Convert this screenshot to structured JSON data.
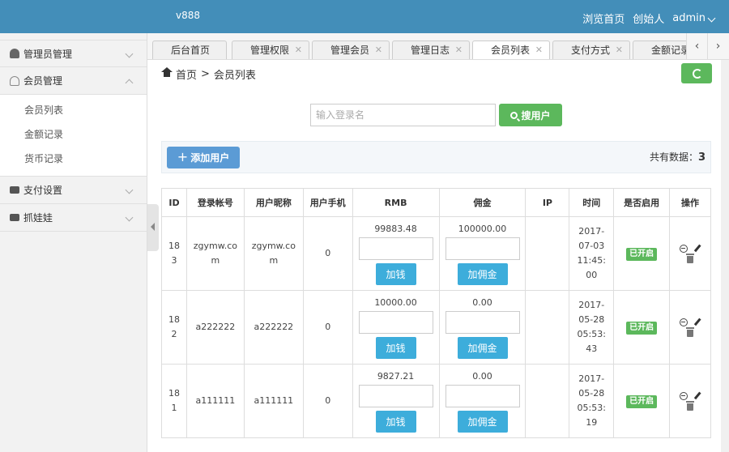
{
  "header": {
    "brand": "v888",
    "browse_home": "浏览首页",
    "role": "创始人",
    "user": "admin"
  },
  "sidebar": {
    "items": [
      {
        "label": "管理员管理",
        "icon": "user-icon",
        "expanded": false
      },
      {
        "label": "会员管理",
        "icon": "user-outline-icon",
        "expanded": true,
        "children": [
          "会员列表",
          "金额记录",
          "货币记录"
        ]
      },
      {
        "label": "支付设置",
        "icon": "card-icon",
        "expanded": false
      },
      {
        "label": "抓娃娃",
        "icon": "card-icon",
        "expanded": false
      }
    ]
  },
  "tabs": [
    {
      "label": "后台首页",
      "closable": false,
      "active": false
    },
    {
      "label": "管理权限",
      "closable": true,
      "active": false
    },
    {
      "label": "管理会员",
      "closable": true,
      "active": false
    },
    {
      "label": "管理日志",
      "closable": true,
      "active": false
    },
    {
      "label": "会员列表",
      "closable": true,
      "active": true
    },
    {
      "label": "支付方式",
      "closable": true,
      "active": false
    },
    {
      "label": "金额记录",
      "closable": false,
      "active": false
    }
  ],
  "tab_nav": {
    "prev": "‹",
    "next": "›"
  },
  "breadcrumb": {
    "home": "首页",
    "separator": ">",
    "current": "会员列表"
  },
  "search": {
    "placeholder": "输入登录名",
    "button": "搜用户"
  },
  "toolbar": {
    "add_label": "添加用户",
    "total_label": "共有数据：",
    "total_count": "3"
  },
  "table": {
    "columns": [
      "ID",
      "登录帐号",
      "用户昵称",
      "用户手机",
      "RMB",
      "佣金",
      "IP",
      "时间",
      "是否启用",
      "操作"
    ],
    "add_money_label": "加钱",
    "add_commission_label": "加佣金",
    "rows": [
      {
        "id": "183",
        "login": "zgymw.com",
        "nickname": "zgymw.com",
        "phone": "0",
        "rmb": "99883.48",
        "commission": "100000.00",
        "ip": "",
        "time": "2017-07-03 11:45:00",
        "status": "已开启"
      },
      {
        "id": "182",
        "login": "a222222",
        "nickname": "a222222",
        "phone": "0",
        "rmb": "10000.00",
        "commission": "0.00",
        "ip": "",
        "time": "2017-05-28 05:53:43",
        "status": "已开启"
      },
      {
        "id": "181",
        "login": "a111111",
        "nickname": "a111111",
        "phone": "0",
        "rmb": "9827.21",
        "commission": "0.00",
        "ip": "",
        "time": "2017-05-28 05:53:19",
        "status": "已开启"
      }
    ]
  },
  "colors": {
    "header": "#438eb9",
    "success": "#5cb85c",
    "primary": "#5b9bd5",
    "info": "#3daddb"
  }
}
